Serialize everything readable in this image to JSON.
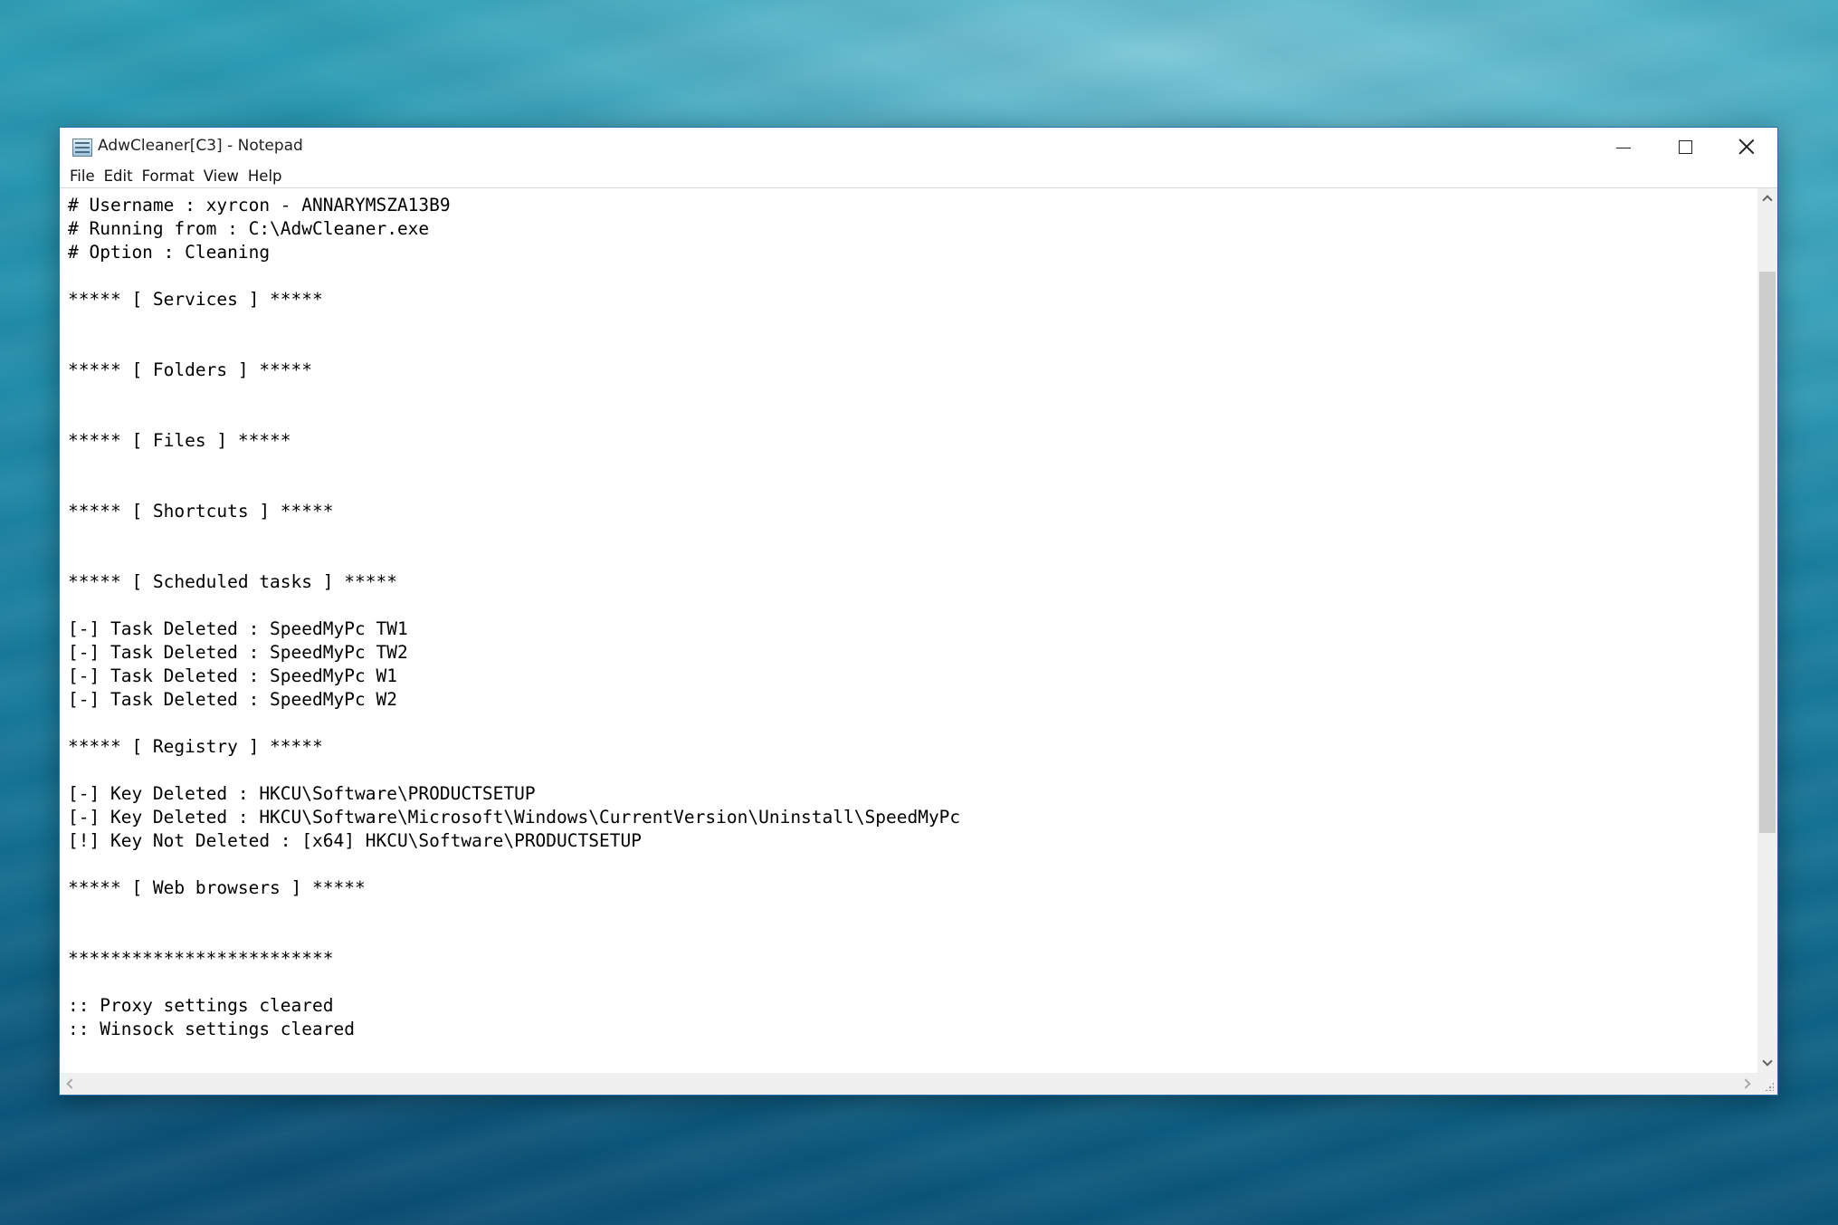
{
  "window": {
    "title": "AdwCleaner[C3] - Notepad",
    "icon": "notepad-icon"
  },
  "controls": {
    "minimize_icon": "minimize-icon",
    "maximize_icon": "maximize-icon",
    "close_icon": "close-icon"
  },
  "menu": {
    "items": [
      "File",
      "Edit",
      "Format",
      "View",
      "Help"
    ]
  },
  "document": {
    "lines": [
      "# Username : xyrcon - ANNARYMSZA13B9",
      "# Running from : C:\\AdwCleaner.exe",
      "# Option : Cleaning",
      "",
      "***** [ Services ] *****",
      "",
      "",
      "***** [ Folders ] *****",
      "",
      "",
      "***** [ Files ] *****",
      "",
      "",
      "***** [ Shortcuts ] *****",
      "",
      "",
      "***** [ Scheduled tasks ] *****",
      "",
      "[-] Task Deleted : SpeedMyPc TW1",
      "[-] Task Deleted : SpeedMyPc TW2",
      "[-] Task Deleted : SpeedMyPc W1",
      "[-] Task Deleted : SpeedMyPc W2",
      "",
      "***** [ Registry ] *****",
      "",
      "[-] Key Deleted : HKCU\\Software\\PRODUCTSETUP",
      "[-] Key Deleted : HKCU\\Software\\Microsoft\\Windows\\CurrentVersion\\Uninstall\\SpeedMyPc",
      "[!] Key Not Deleted : [x64] HKCU\\Software\\PRODUCTSETUP",
      "",
      "***** [ Web browsers ] *****",
      "",
      "",
      "*************************",
      "",
      ":: Proxy settings cleared",
      ":: Winsock settings cleared"
    ]
  }
}
